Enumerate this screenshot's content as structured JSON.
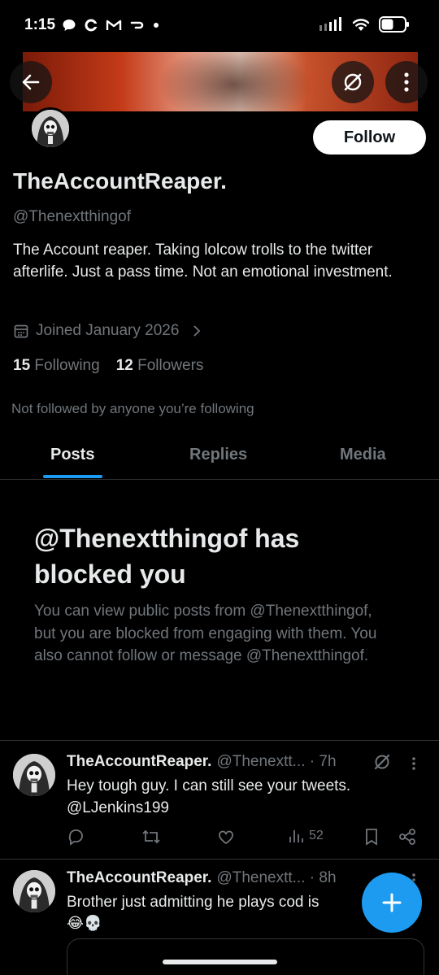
{
  "status_bar": {
    "time": "1:15"
  },
  "profile": {
    "display_name": "TheAccountReaper.",
    "handle": "@Thenextthingof",
    "bio": "The Account reaper. Taking lolcow trolls to the twitter afterlife.  Just a pass time. Not an emotional investment.",
    "joined": "Joined January 2026",
    "following_count": "15",
    "following_label": "Following",
    "followers_count": "12",
    "followers_label": "Followers",
    "not_followed_text": "Not followed by anyone you’re following",
    "follow_button": "Follow"
  },
  "tabs": [
    {
      "label": "Posts",
      "active": true
    },
    {
      "label": "Replies",
      "active": false
    },
    {
      "label": "Media",
      "active": false
    }
  ],
  "blocked_notice": {
    "title": "@Thenextthingof has blocked you",
    "text": "You can view public posts from @Thenextthingof, but you are blocked from engaging with them. You also cannot follow or message @Thenextthingof."
  },
  "tweets": [
    {
      "display_name": "TheAccountReaper.",
      "meta": "@Thenextt... · 7h",
      "text": "Hey tough guy. I can still see your tweets. @LJenkins199",
      "views": "52"
    },
    {
      "display_name": "TheAccountReaper.",
      "meta": "@Thenextt... · 8h",
      "text": "Brother just admitting he plays  cod is",
      "text2": "😂💀"
    }
  ],
  "colors": {
    "accent": "#1d9bf0",
    "muted": "#71767b",
    "text": "#e7e9ea",
    "border": "#2f3336"
  }
}
